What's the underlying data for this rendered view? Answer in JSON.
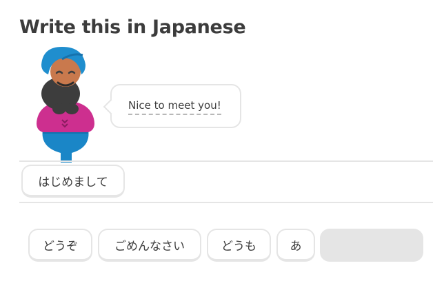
{
  "header": {
    "title": "Write this in Japanese"
  },
  "prompt": {
    "sentence": "Nice to meet you!"
  },
  "answer": {
    "selected_tiles": [
      {
        "label": "はじめまして"
      }
    ]
  },
  "word_bank": {
    "tiles": [
      {
        "label": "どうぞ"
      },
      {
        "label": "ごめんなさい"
      },
      {
        "label": "どうも"
      },
      {
        "label": "あ"
      }
    ]
  },
  "colors": {
    "text": "#3c3c3c",
    "border": "#e5e5e5",
    "placeholder": "#e5e5e5",
    "turban": "#1f8ece",
    "skin": "#c9794d",
    "beard": "#3d3d3d",
    "shirt": "#cd2f8f",
    "pants": "#1a86c7"
  },
  "icons": {
    "character": "turbaned-man-character"
  }
}
